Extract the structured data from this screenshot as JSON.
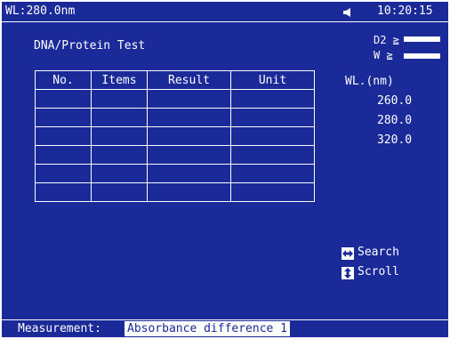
{
  "top_bar": {
    "wavelength": "WL:280.0nm",
    "clock": "10:20:15",
    "speaker_icon": "speaker-icon"
  },
  "title": "DNA/Protein Test",
  "lamps": [
    {
      "label": "D2 ≧",
      "status": "on"
    },
    {
      "label": "W ≧",
      "status": "on"
    }
  ],
  "table": {
    "headers": [
      "No.",
      "Items",
      "Result",
      "Unit"
    ],
    "rows": [
      [
        "",
        "",
        "",
        ""
      ],
      [
        "",
        "",
        "",
        ""
      ],
      [
        "",
        "",
        "",
        ""
      ],
      [
        "",
        "",
        "",
        ""
      ],
      [
        "",
        "",
        "",
        ""
      ],
      [
        "",
        "",
        "",
        ""
      ]
    ]
  },
  "wavelengths": {
    "header": "WL.(nm)",
    "values": [
      "260.0",
      "280.0",
      "320.0"
    ]
  },
  "hints": [
    {
      "icon": "left-right-arrow-icon",
      "label": "Search"
    },
    {
      "icon": "up-down-arrow-icon",
      "label": "Scroll"
    }
  ],
  "status_bar": {
    "label": "Measurement:",
    "value": "Absorbance difference 1"
  },
  "colors": {
    "background": "#1a2a99",
    "foreground": "#ffffff"
  }
}
